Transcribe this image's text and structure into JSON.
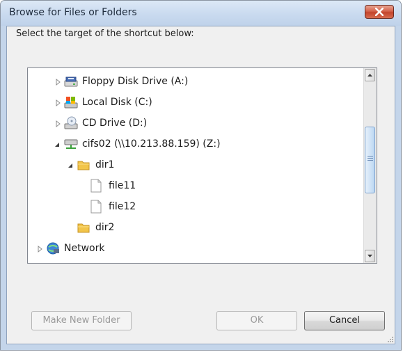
{
  "window": {
    "title": "Browse for Files or Folders"
  },
  "instructions": "Select the target of the shortcut below:",
  "tree": {
    "items": [
      {
        "label": "Floppy Disk Drive (A:)",
        "icon": "floppy-drive-icon",
        "expander": "collapsed"
      },
      {
        "label": "Local Disk (C:)",
        "icon": "local-disk-icon",
        "expander": "collapsed"
      },
      {
        "label": "CD Drive (D:)",
        "icon": "cd-drive-icon",
        "expander": "collapsed"
      },
      {
        "label": "cifs02 (\\\\10.213.88.159) (Z:)",
        "icon": "network-drive-icon",
        "expander": "expanded"
      },
      {
        "label": "dir1",
        "icon": "folder-icon",
        "expander": "expanded"
      },
      {
        "label": "file11",
        "icon": "file-icon",
        "expander": "none"
      },
      {
        "label": "file12",
        "icon": "file-icon",
        "expander": "none"
      },
      {
        "label": "dir2",
        "icon": "folder-icon",
        "expander": "none"
      },
      {
        "label": "Network",
        "icon": "network-icon",
        "expander": "collapsed"
      }
    ]
  },
  "buttons": {
    "make_new_folder": "Make New Folder",
    "ok": "OK",
    "cancel": "Cancel"
  },
  "colors": {
    "title_bar": "#c9daef",
    "close_button": "#c3442c",
    "scroll_thumb": "#bcd7f2"
  }
}
